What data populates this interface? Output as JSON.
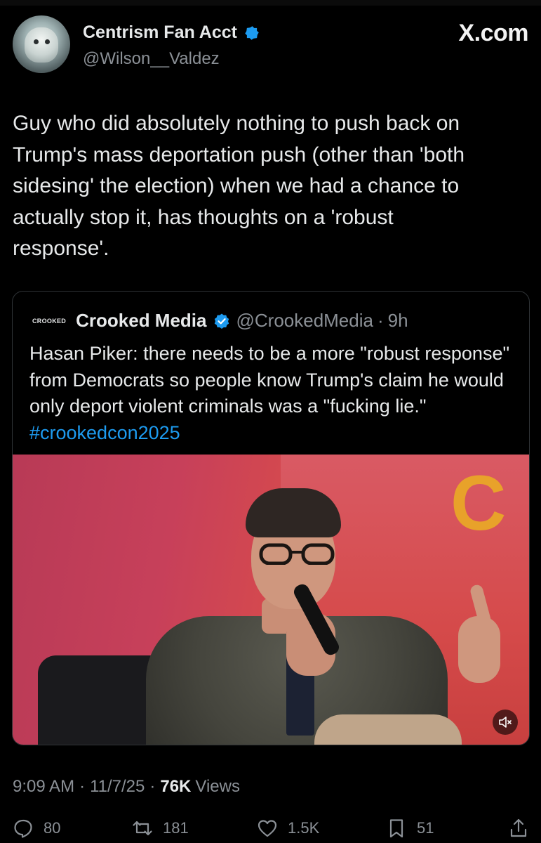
{
  "author": {
    "display_name": "Centrism Fan Acct",
    "handle": "@Wilson__Valdez",
    "verified": true,
    "avatar": "avatar-icon"
  },
  "watermark": "X.com",
  "post": {
    "text": "Guy who did absolutely nothing to push back on\nTrump's mass deportation push (other than 'both\nsidesing' the election) when we had a chance to\nactually stop it, has thoughts on a 'robust\nresponse'."
  },
  "quoted": {
    "logo_text": "CROOKED",
    "display_name": "Crooked Media",
    "handle": "@CrookedMedia",
    "separator": "·",
    "time": "9h",
    "text": "Hasan Piker: there needs to be a more \"robust response\" from Democrats so people know Trump's claim he would only deport violent criminals was a \"fucking lie.\"",
    "hashtag": "#crookedcon2025",
    "media_banner_text": "C"
  },
  "meta": {
    "time": "9:09 AM",
    "date": "11/7/25",
    "views_count": "76K",
    "views_label": "Views",
    "separator": "·"
  },
  "actions": {
    "replies": "80",
    "reposts": "181",
    "likes": "1.5K",
    "bookmarks": "51"
  },
  "colors": {
    "background": "#000000",
    "text": "#e7e9ea",
    "secondary": "#8b9096",
    "link": "#1d9bf0",
    "verified": "#1d9bf0"
  }
}
